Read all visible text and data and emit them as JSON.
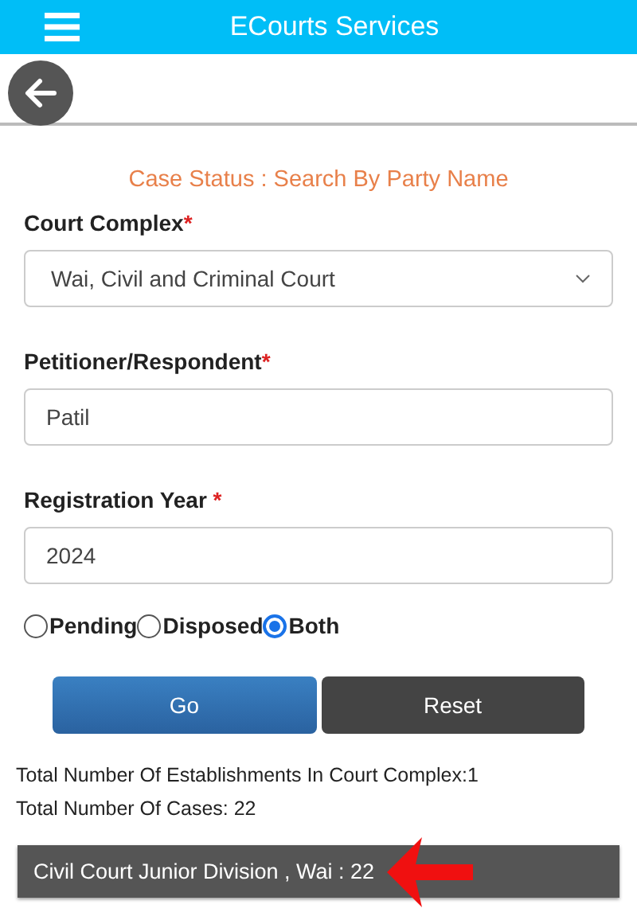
{
  "header": {
    "title": "ECourts Services"
  },
  "page_title": "Case Status : Search By Party Name",
  "fields": [
    {
      "kind": "select",
      "label": "Court Complex",
      "required_mark": "*",
      "value": "Wai, Civil and Criminal Court"
    },
    {
      "kind": "text",
      "label": "Petitioner/Respondent",
      "required_mark": "*",
      "value": "Patil"
    },
    {
      "kind": "text",
      "label": "Registration Year ",
      "required_mark": "*",
      "value": "2024"
    }
  ],
  "status_options": [
    {
      "label": "Pending",
      "selected": false
    },
    {
      "label": "Disposed",
      "selected": false
    },
    {
      "label": "Both",
      "selected": true
    }
  ],
  "buttons": [
    {
      "kind": "primary",
      "label": "Go"
    },
    {
      "kind": "secondary",
      "label": "Reset"
    }
  ],
  "totals": [
    "Total Number Of Establishments In Court Complex:1",
    "Total Number Of Cases: 22"
  ],
  "results": [
    {
      "label": "Civil Court Junior Division , Wai : 22",
      "highlighted": true
    }
  ]
}
